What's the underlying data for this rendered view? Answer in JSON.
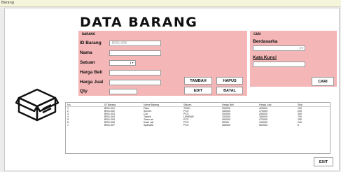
{
  "window": {
    "title": "Barang"
  },
  "heading": "DATA BARANG",
  "barang_panel": {
    "title": "BARANG",
    "labels": {
      "id": "ID Barang",
      "nama": "Nama",
      "satuan": "Satuan",
      "harga_beli": "Harga Beli",
      "harga_jual": "Harga Jual",
      "qty": "Qty"
    },
    "id_value": "BRG-008",
    "nama_value": "",
    "satuan_value": "",
    "harga_beli_value": "",
    "harga_jual_value": "",
    "qty_value": ""
  },
  "buttons": {
    "tambah": "TAMBAH",
    "hapus": "HAPUS",
    "edit": "EDIT",
    "batal": "BATAL",
    "cari": "CARI",
    "exit": "EXIT"
  },
  "cari_panel": {
    "title": "CARI",
    "berdasarkan_label": "Berdasarka",
    "berdasarkan_value": "",
    "kata_kunci_label": "Kata Kunci",
    "kata_kunci_value": ""
  },
  "table": {
    "headers": [
      "No.",
      "ID Barang",
      "Nama Barang",
      "Satuan",
      "Harga Beli",
      "Harga Jual",
      "Stok"
    ],
    "rows": [
      [
        "1",
        "BRG-001",
        "Paku",
        "TRUK",
        "250000",
        "400000",
        "100"
      ],
      [
        "2",
        "BRG-002",
        "Semen",
        "PCS",
        "150000",
        "170000",
        "200"
      ],
      [
        "3",
        "BRG-003",
        "Cat",
        "PCS",
        "200000",
        "250000",
        "300"
      ],
      [
        "4",
        "BRG-004",
        "Triplek",
        "LEMBAR",
        "100000",
        "180000",
        "700"
      ],
      [
        "5",
        "BRG-005",
        "Toren air",
        "PCS",
        "450000",
        "470000",
        "250"
      ],
      [
        "6",
        "BRG-006",
        "Kuas cat",
        "PCS",
        "50000",
        "100000",
        "240"
      ],
      [
        "7",
        "BRG-007",
        "Spandek",
        "PCS",
        "450000",
        "500000",
        "6"
      ]
    ]
  },
  "icon": "box-icon"
}
